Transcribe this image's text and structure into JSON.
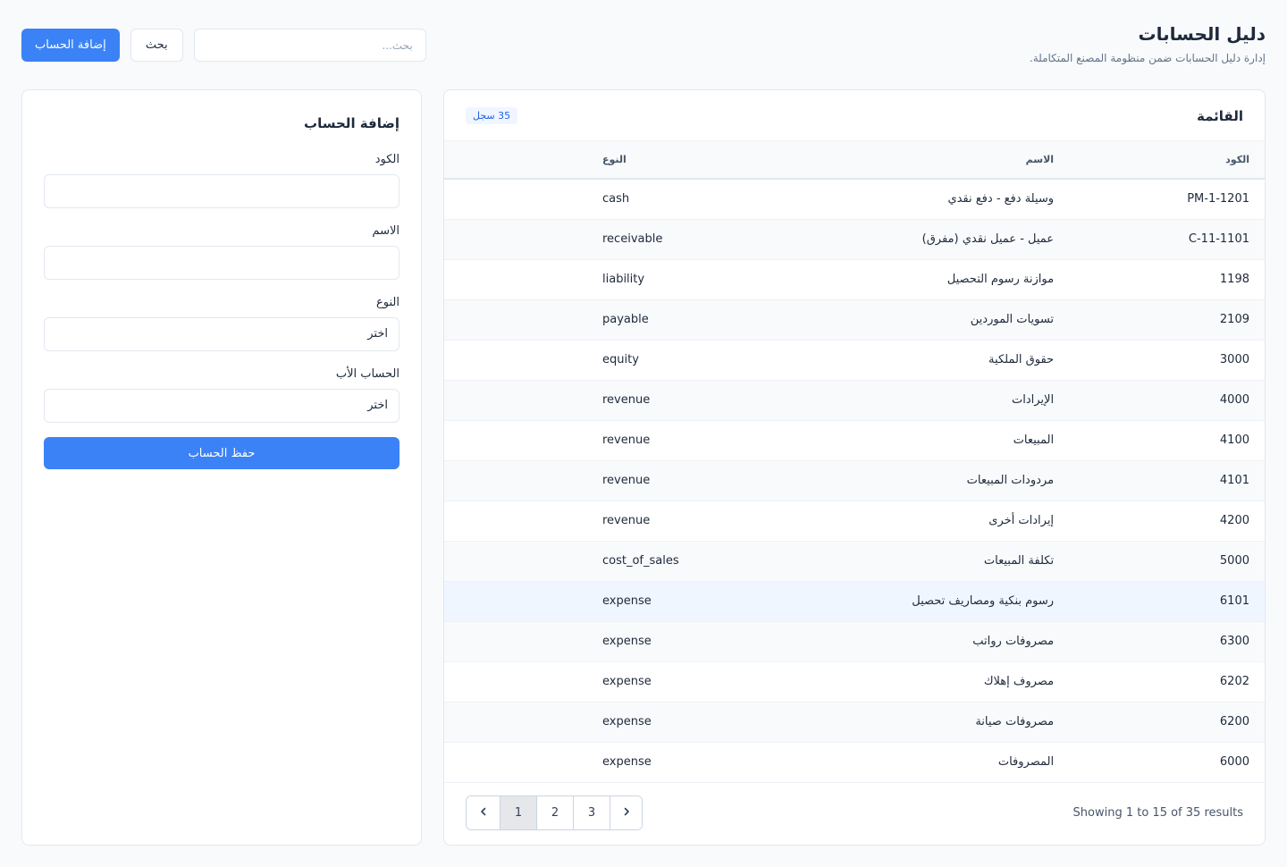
{
  "header": {
    "title": "دليل الحسابات",
    "subtitle": "إدارة دليل الحسابات ضمن منظومة المصنع المتكاملة.",
    "add_button": "إضافة الحساب",
    "search_button": "بحث",
    "search_placeholder": "بحث..."
  },
  "list": {
    "title": "القائمة",
    "count_badge": "35 سجل",
    "columns": {
      "code": "الكود",
      "name": "الاسم",
      "type": "النوع"
    },
    "rows": [
      {
        "code": "PM-1-1201",
        "name": "وسيلة دفع - دفع نقدي",
        "type": "cash"
      },
      {
        "code": "C-11-1101",
        "name": "عميل - عميل نقدي (مفرق)",
        "type": "receivable"
      },
      {
        "code": "1198",
        "name": "موازنة رسوم التحصيل",
        "type": "liability"
      },
      {
        "code": "2109",
        "name": "تسويات الموردين",
        "type": "payable"
      },
      {
        "code": "3000",
        "name": "حقوق الملكية",
        "type": "equity"
      },
      {
        "code": "4000",
        "name": "الإيرادات",
        "type": "revenue"
      },
      {
        "code": "4100",
        "name": "المبيعات",
        "type": "revenue"
      },
      {
        "code": "4101",
        "name": "مردودات المبيعات",
        "type": "revenue"
      },
      {
        "code": "4200",
        "name": "إيرادات أخرى",
        "type": "revenue"
      },
      {
        "code": "5000",
        "name": "تكلفة المبيعات",
        "type": "cost_of_sales"
      },
      {
        "code": "6101",
        "name": "رسوم بنكية ومصاريف تحصيل",
        "type": "expense"
      },
      {
        "code": "6300",
        "name": "مصروفات رواتب",
        "type": "expense"
      },
      {
        "code": "6202",
        "name": "مصروف إهلاك",
        "type": "expense"
      },
      {
        "code": "6200",
        "name": "مصروفات صيانة",
        "type": "expense"
      },
      {
        "code": "6000",
        "name": "المصروفات",
        "type": "expense"
      }
    ],
    "results_text": "Showing 1 to 15 of 35 results",
    "pages": [
      "1",
      "2",
      "3"
    ],
    "active_page": "1",
    "prev_icon": "‹",
    "next_icon": "›"
  },
  "form": {
    "title": "إضافة الحساب",
    "code_label": "الكود",
    "name_label": "الاسم",
    "type_label": "النوع",
    "type_value": "اختر",
    "parent_label": "الحساب الأب",
    "parent_value": "اختر",
    "save_button": "حفظ الحساب"
  },
  "colors": {
    "primary": "#3b82f6",
    "badge_bg": "#eff6ff",
    "badge_text": "#2563eb"
  }
}
